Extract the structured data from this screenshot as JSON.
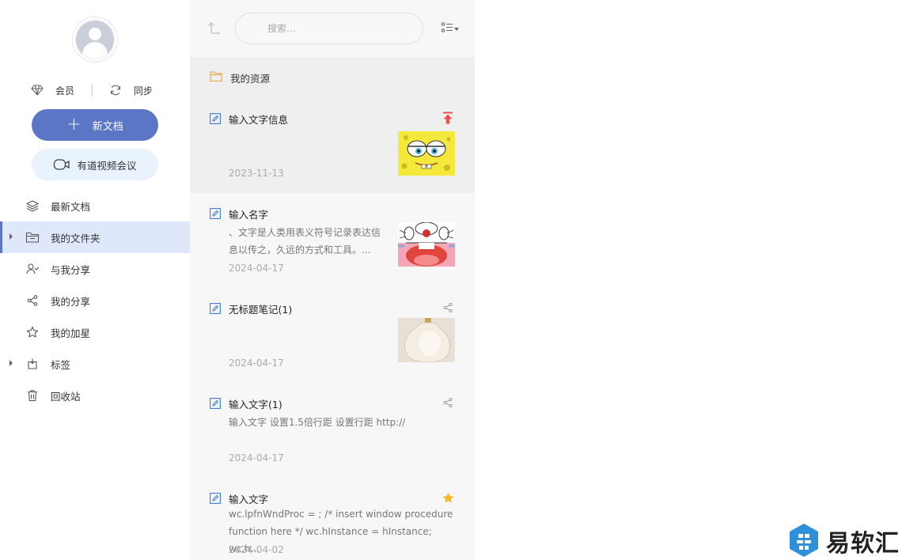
{
  "sidebar": {
    "member_label": "会员",
    "sync_label": "同步",
    "new_doc_label": "新文档",
    "video_meeting_label": "有道视频会议",
    "nav": [
      {
        "label": "最新文档",
        "icon": "layers-icon"
      },
      {
        "label": "我的文件夹",
        "icon": "folder-icon",
        "active": true
      },
      {
        "label": "与我分享",
        "icon": "shared-users-icon"
      },
      {
        "label": "我的分享",
        "icon": "share-icon"
      },
      {
        "label": "我的加星",
        "icon": "star-icon"
      },
      {
        "label": "标签",
        "icon": "tag-icon"
      },
      {
        "label": "回收站",
        "icon": "trash-icon"
      }
    ]
  },
  "list": {
    "search_placeholder": "搜索...",
    "folder_label": "我的资源",
    "notes": [
      {
        "title": "输入文字信息",
        "excerpt": "",
        "date": "2023-11-13",
        "badge": "pin-top-icon",
        "thumb": "spongebob-thumbnail"
      },
      {
        "title": "输入名字",
        "excerpt": "、文字是人类用表义符号记录表达信息以传之，久远的方式和工具。...",
        "date": "2024-04-17",
        "badge": "",
        "thumb": "doraemon-thumbnail"
      },
      {
        "title": "无标题笔记(1)",
        "excerpt": "",
        "date": "2024-04-17",
        "badge": "share-icon",
        "thumb": "bottle-thumbnail"
      },
      {
        "title": "输入文字(1)",
        "excerpt": "输入文字 设置1.5倍行距 设置行距 http://",
        "date": "2024-04-17",
        "badge": "share-icon",
        "thumb": ""
      },
      {
        "title": "输入文字",
        "excerpt": "wc.lpfnWndProc = ; /* insert window procedure function here */ wc.hInstance = hInstance; wc.h...",
        "date": "2024-04-02",
        "badge": "star-icon",
        "thumb": ""
      }
    ]
  },
  "watermark": {
    "text": "易软汇"
  },
  "colors": {
    "accent": "#5b76c5",
    "active_bg": "#dfe8fb",
    "pin": "#e8504a",
    "star": "#f5b820"
  }
}
